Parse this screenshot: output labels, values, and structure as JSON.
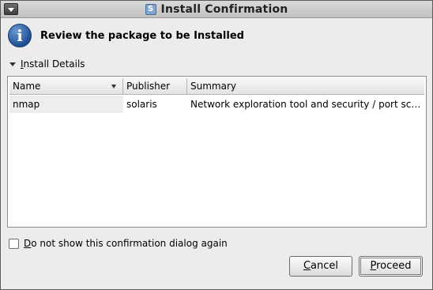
{
  "window": {
    "title": "Install Confirmation",
    "title_icon": "S"
  },
  "header": {
    "icon": "info-icon",
    "message": "Review the package to be Installed"
  },
  "details": {
    "expander_label": "Install Details",
    "columns": [
      "Name",
      "Publisher",
      "Summary"
    ],
    "rows": [
      {
        "name": "nmap",
        "publisher": "solaris",
        "summary": "Network exploration tool and security / port sca..."
      }
    ]
  },
  "options": {
    "dont_show_again_label": "Do not show this confirmation dialog again",
    "dont_show_again_checked": false
  },
  "buttons": {
    "cancel_label": "Cancel",
    "proceed_label": "Proceed"
  }
}
